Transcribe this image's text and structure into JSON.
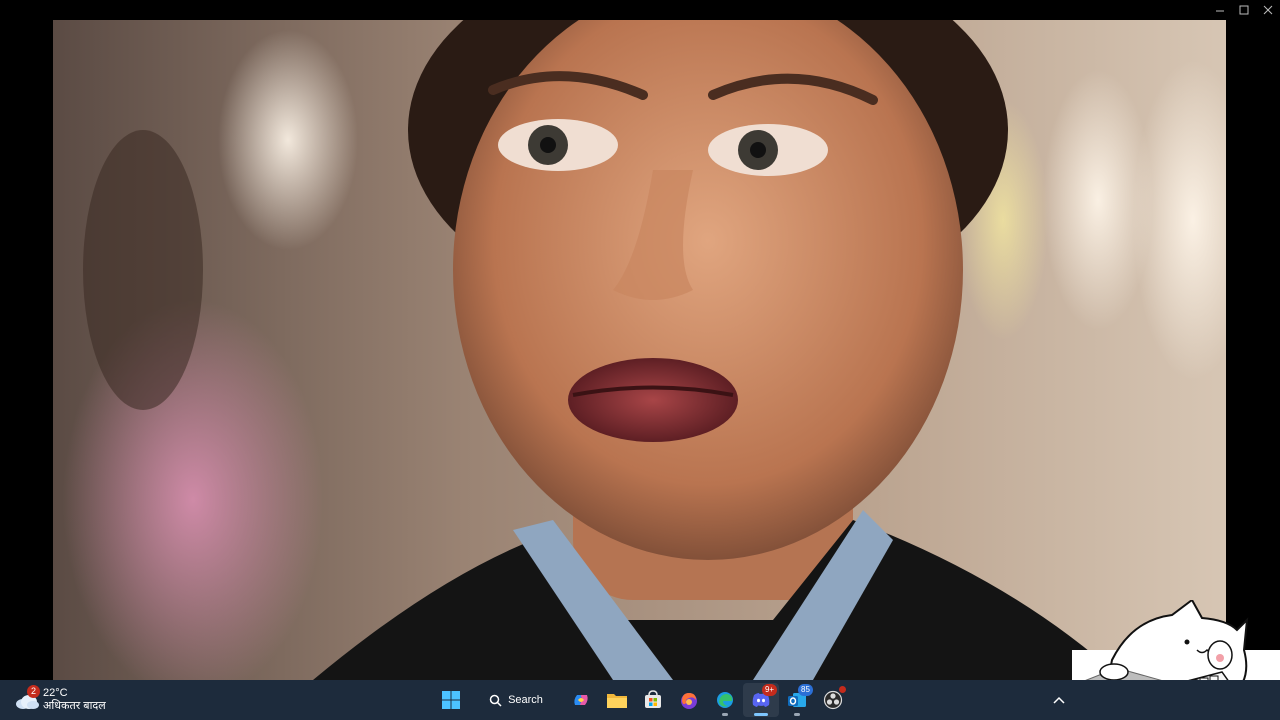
{
  "window": {
    "controls": [
      {
        "name": "minimize",
        "glyph": "—"
      },
      {
        "name": "maximize",
        "glyph": "☐"
      },
      {
        "name": "close",
        "glyph": "✕"
      }
    ]
  },
  "video": {
    "description_icon": "video-frame"
  },
  "taskbar": {
    "weather": {
      "temperature": "22°C",
      "condition": "अधिकतर बादल",
      "badge_count": "2"
    },
    "search_label": "Search",
    "apps": [
      {
        "name": "start",
        "icon": "windows-icon"
      },
      {
        "name": "copilot",
        "icon": "copilot-icon"
      },
      {
        "name": "file-explorer",
        "icon": "folder-icon"
      },
      {
        "name": "microsoft-store",
        "icon": "store-icon"
      },
      {
        "name": "firefox",
        "icon": "firefox-icon"
      },
      {
        "name": "edge",
        "icon": "edge-icon"
      },
      {
        "name": "discord",
        "icon": "discord-icon",
        "badge": "9+"
      },
      {
        "name": "outlook",
        "icon": "outlook-icon",
        "badge": "85"
      },
      {
        "name": "obs",
        "icon": "obs-icon"
      }
    ],
    "tray_chevron": "^"
  },
  "colors": {
    "taskbar_bg": "#1d2b3c",
    "badge_red": "#c42b1c",
    "active_indicator": "#7ec6ff"
  }
}
